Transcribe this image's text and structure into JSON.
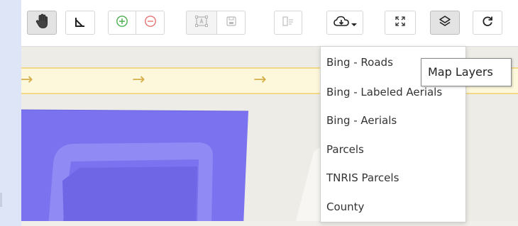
{
  "toolbar": {
    "buttons": [
      {
        "name": "pan-tool",
        "icon": "hand-icon",
        "state": "active"
      },
      {
        "name": "measure-tool",
        "icon": "ruler-angle-icon"
      },
      {
        "name": "zoom-in",
        "icon": "plus-circle-icon"
      },
      {
        "name": "zoom-out",
        "icon": "minus-circle-icon"
      },
      {
        "name": "select-area",
        "icon": "select-area-icon",
        "state": "disabled"
      },
      {
        "name": "save-map",
        "icon": "save-icon",
        "state": "disabled"
      },
      {
        "name": "list-layers",
        "icon": "list-icon",
        "state": "disabled"
      },
      {
        "name": "basemap-select",
        "icon": "cloud-download-icon",
        "has_caret": true
      },
      {
        "name": "fullscreen",
        "icon": "expand-icon"
      },
      {
        "name": "map-layers",
        "icon": "layers-icon"
      },
      {
        "name": "refresh",
        "icon": "refresh-icon"
      }
    ]
  },
  "basemap_menu": {
    "items": [
      {
        "label": "Bing - Roads"
      },
      {
        "label": "Bing - Labeled Aerials"
      },
      {
        "label": "Bing - Aerials"
      },
      {
        "label": "Parcels"
      },
      {
        "label": "TNRIS Parcels"
      },
      {
        "label": "County"
      }
    ]
  },
  "tooltip": {
    "text": "Map Layers"
  },
  "colors": {
    "parcel_fill": "#7a72ee",
    "parcel_inner": "#8f88f3",
    "road_band": "#fdf8dc",
    "road_arrow": "#d6ae4a",
    "map_background": "#eeece7",
    "zoom_in": "#4caf50",
    "zoom_out": "#e57373"
  },
  "map": {
    "direction_arrows": [
      "→",
      "→",
      "→"
    ]
  }
}
